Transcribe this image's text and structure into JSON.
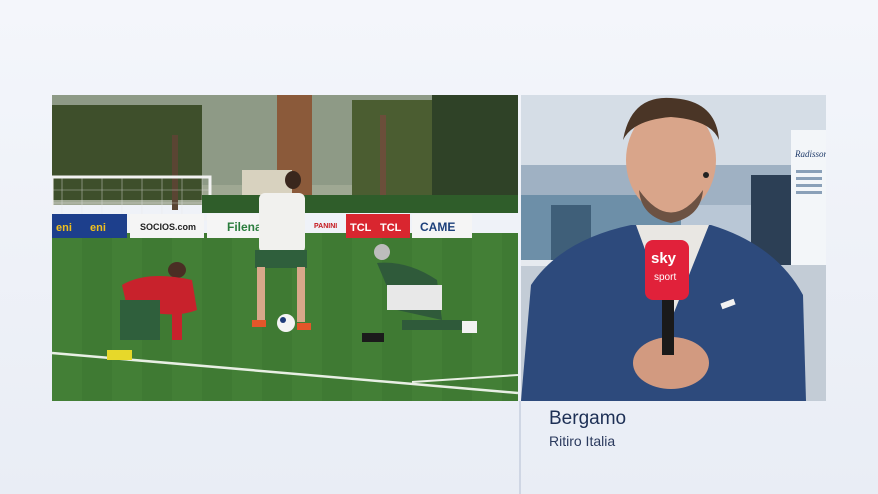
{
  "caption": {
    "location": "Bergamo",
    "subtitle": "Ritiro Italia"
  },
  "left_feed": {
    "ad_boards": [
      "eni",
      "eni",
      "SOCIOS.com",
      "Filena",
      "PANINI",
      "TCL",
      "TCL",
      "CAME"
    ]
  },
  "right_feed": {
    "mic_brand": "sky",
    "mic_sub": "sport",
    "sign_text": "Radisson"
  },
  "colors": {
    "caption_text": "#1d2f55",
    "grass": "#3f7a33",
    "sky_mic": "#e1213a"
  }
}
